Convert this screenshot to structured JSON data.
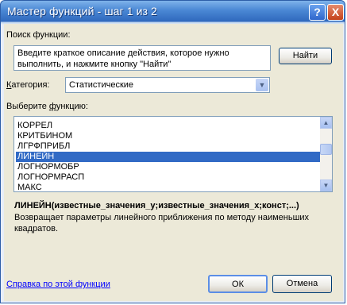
{
  "window": {
    "title": "Мастер функций - шаг 1 из 2",
    "help_glyph": "?",
    "close_glyph": "X"
  },
  "search": {
    "label": "Поиск функции:",
    "value": "Введите краткое описание действия, которое нужно выполнить, и нажмите кнопку \"Найти\"",
    "find_button": "Найти"
  },
  "category": {
    "label_key": "К",
    "label_rest": "атегория:",
    "value": "Статистические"
  },
  "functions": {
    "label_pre": "Выберите ",
    "label_key": "ф",
    "label_post": "ункцию:",
    "items": [
      "КОРРЕЛ",
      "КРИТБИНОМ",
      "ЛГРФПРИБЛ",
      "ЛИНЕЙН",
      "ЛОГНОРМОБР",
      "ЛОГНОРМРАСП",
      "МАКС"
    ],
    "selected_index": 3
  },
  "syntax": "ЛИНЕЙН(известные_значения_y;известные_значения_x;конст;...)",
  "description": "Возвращает параметры линейного приближения по методу наименьших квадратов.",
  "help_link": "Справка по этой функции",
  "ok_button": "ОК",
  "cancel_button": "Отмена"
}
